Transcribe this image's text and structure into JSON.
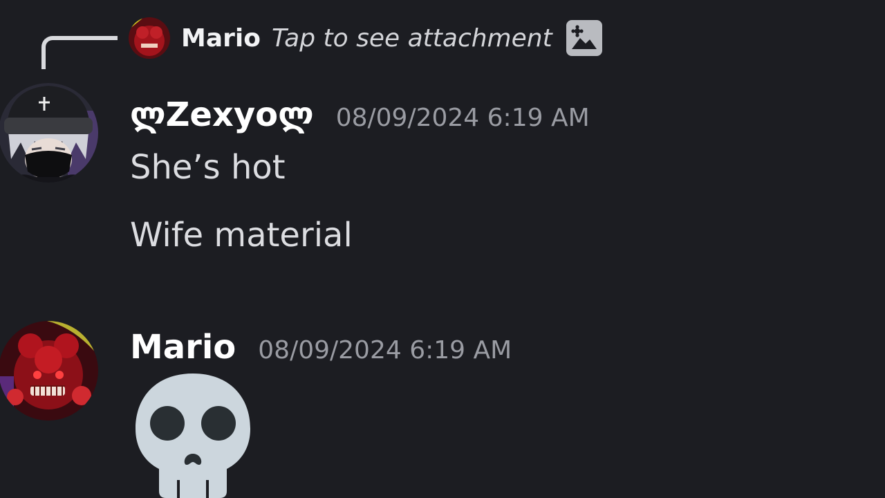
{
  "reply": {
    "author": "Mario",
    "preview": "Tap to see attachment",
    "attachment_icon": "image-icon"
  },
  "messages": [
    {
      "author": "ლZexyoლ",
      "timestamp": "08/09/2024 6:19 AM",
      "lines": [
        "She’s hot",
        "Wife material"
      ]
    },
    {
      "author": "Mario",
      "timestamp": "08/09/2024 6:19 AM",
      "emoji": "skull-emoji"
    }
  ],
  "colors": {
    "background": "#1c1d22",
    "username": "#ffffff",
    "timestamp": "#9a9ca3",
    "message_text": "#dcdde1",
    "reply_spine": "#d9dade"
  }
}
